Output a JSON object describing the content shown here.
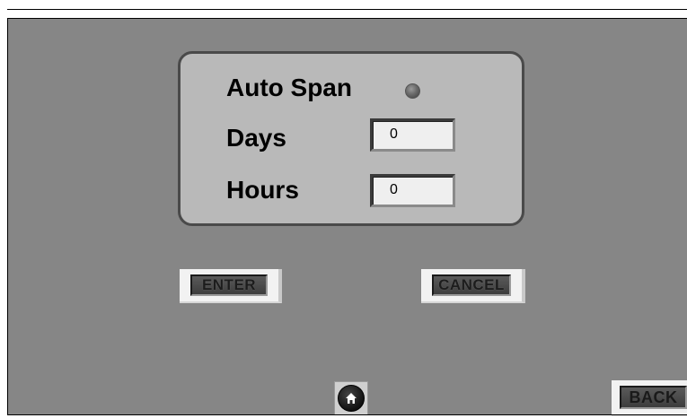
{
  "settings": {
    "auto_span_label": "Auto Span",
    "days_label": "Days",
    "hours_label": "Hours",
    "days_value": "0",
    "hours_value": "0",
    "auto_span_indicator_state": "off"
  },
  "buttons": {
    "enter_label": "ENTER",
    "cancel_label": "CANCEL",
    "back_label": "BACK"
  },
  "icons": {
    "home": "home-icon",
    "indicator": "status-led-icon"
  },
  "colors": {
    "background": "#868686",
    "settings_box": "#b9b9b9",
    "indicator_off": "#6b6b6b",
    "field_bg": "#efefef"
  }
}
